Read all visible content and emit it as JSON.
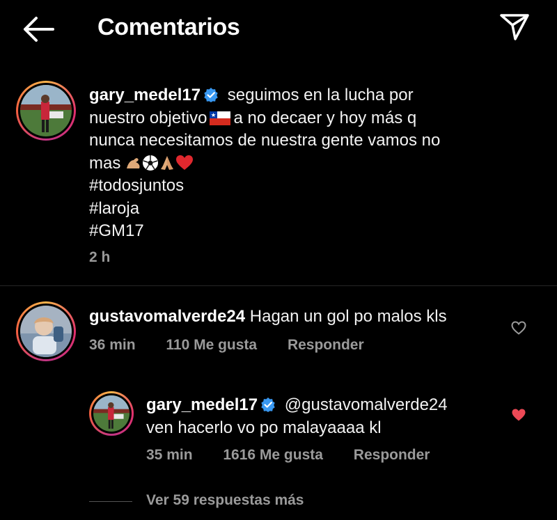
{
  "header": {
    "title": "Comentarios",
    "back_icon": "arrow-left-icon",
    "send_icon": "paper-plane-icon"
  },
  "caption": {
    "username": "gary_medel17",
    "verified": true,
    "line1": "seguimos en la lucha por",
    "line2a": "nuestro objetivo",
    "line2b": "a no decaer y hoy más q",
    "line3": "nunca necesitamos de nuestra gente vamos no",
    "line4": "mas",
    "emojis": [
      "flexed-biceps",
      "soccer-ball",
      "folded-hands",
      "red-heart"
    ],
    "hashtags": [
      "#todosjuntos",
      "#laroja",
      "#GM17"
    ],
    "time": "2 h"
  },
  "comment": {
    "username": "gustavomalverde24",
    "text": "Hagan un gol po malos kls",
    "time": "36 min",
    "likes": "110 Me gusta",
    "reply": "Responder",
    "liked": false
  },
  "reply": {
    "username": "gary_medel17",
    "verified": true,
    "mention": "@gustavomalverde24",
    "text": "ven hacerlo vo po malayaaaa kl",
    "time": "35 min",
    "likes": "1616 Me gusta",
    "reply": "Responder",
    "liked": true
  },
  "more_replies": "Ver 59 respuestas más",
  "colors": {
    "background": "#000000",
    "text": "#f2f2f2",
    "meta": "#9a9a9a",
    "verified": "#3897f0",
    "liked_heart": "#ed4956"
  }
}
